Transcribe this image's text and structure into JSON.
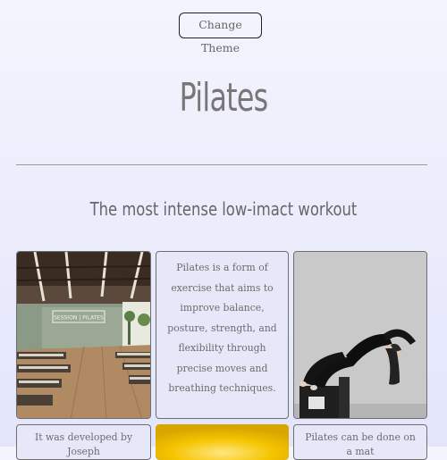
{
  "header": {
    "theme_button_label": "Change Theme",
    "title": "Pilates",
    "subtitle": "The most intense low-imact workout"
  },
  "cards": [
    {
      "type": "image",
      "icon": "studio-photo",
      "sign_text": "SESSION | PILATES"
    },
    {
      "type": "text",
      "text": "Pilates is a form of exercise that aims to improve balance, posture, strength, and flexibility through precise moves and breathing techniques."
    },
    {
      "type": "image",
      "icon": "woman-stretching-photo"
    },
    {
      "type": "text",
      "text": "It was developed by Joseph"
    },
    {
      "type": "image",
      "icon": "yellow-gradient-image",
      "accent": "#f5c400"
    },
    {
      "type": "text",
      "text": "Pilates can be done on a mat"
    }
  ],
  "colors": {
    "background": "#eceefc",
    "border": "#6e6e6e",
    "text": "#6b6b6b",
    "accent_yellow": "#f5c400"
  }
}
